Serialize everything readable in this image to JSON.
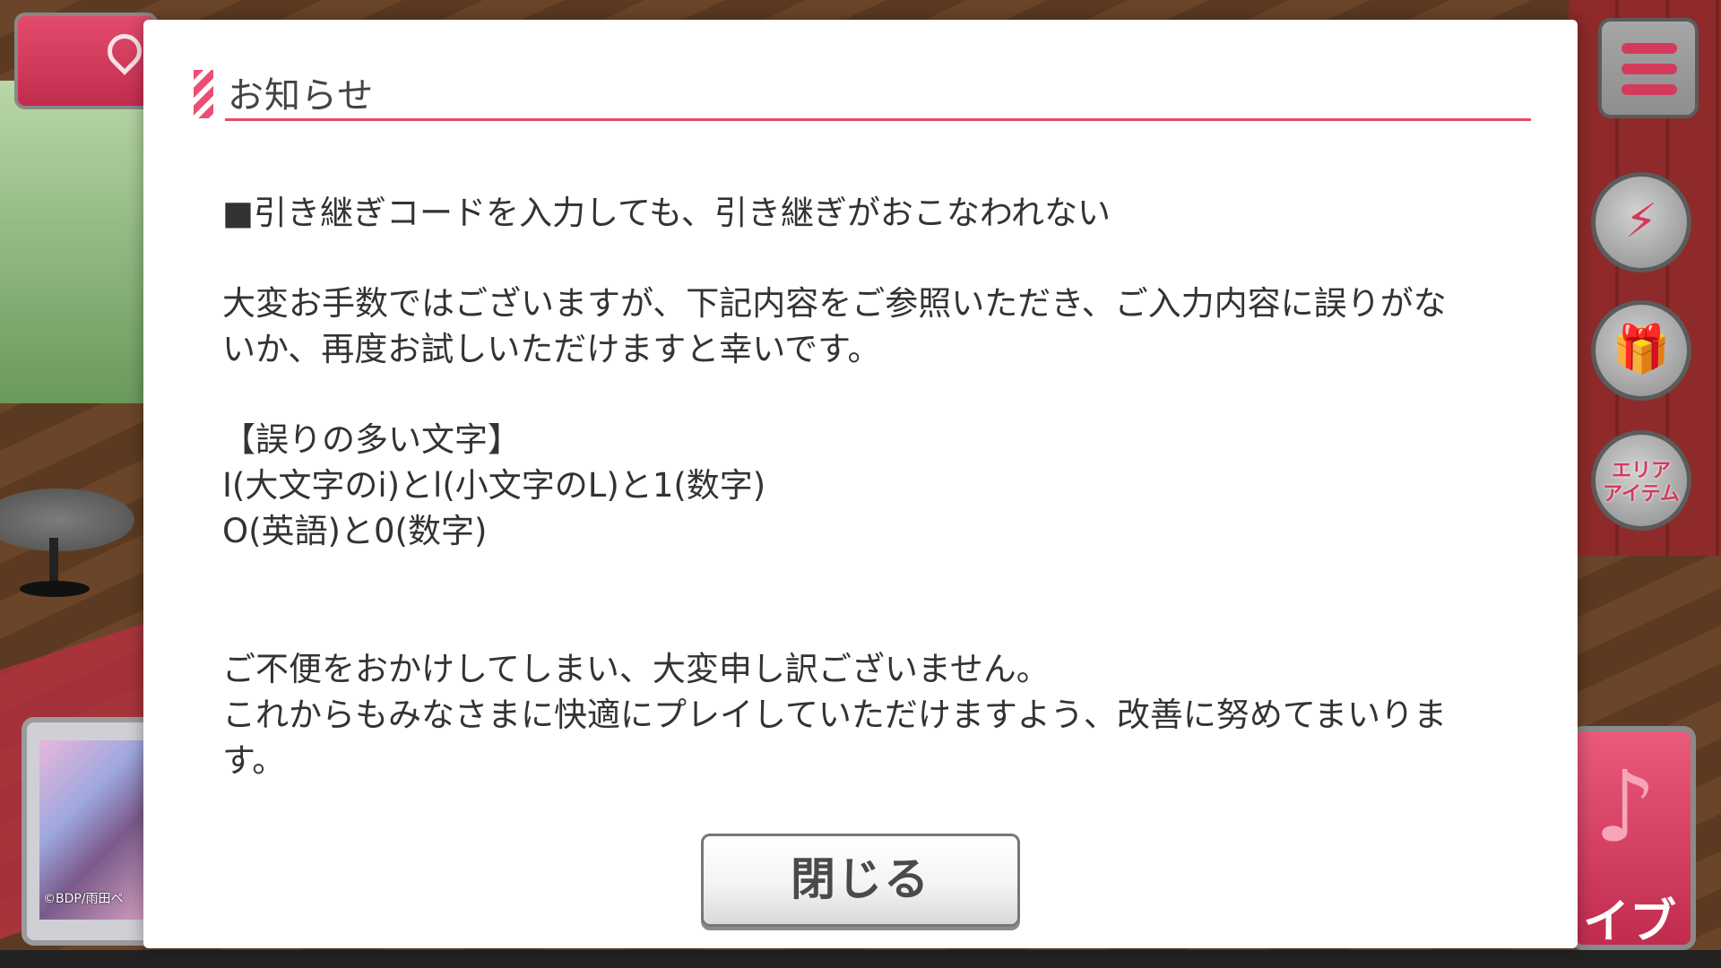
{
  "dialog": {
    "title": "お知らせ",
    "heading": "■引き継ぎコードを入力しても、引き継ぎがおこなわれない",
    "paragraph1_line1": "大変お手数ではございますが、下記内容をご参照いただき、ご入力内容に誤りがな",
    "paragraph1_line2": "いか、再度お試しいただけますと幸いです。",
    "list_heading": "【誤りの多い文字】",
    "list_item1": "I(大文字のi)とl(小文字のL)と1(数字)",
    "list_item2": "O(英語)と0(数字)",
    "closing_line1": "ご不便をおかけしてしまい、大変申し訳ございません。",
    "closing_line2": "これからもみなさまに快適にプレイしていただけますよう、改善に努めてまいりま",
    "closing_line3": "す。",
    "close_button_label": "閉じる"
  },
  "background": {
    "area_item_button_label_line1": "エリア",
    "area_item_button_label_line2": "アイテム",
    "card_credit": "©BDP/雨田ペ",
    "live_button_label": "イブ"
  },
  "icons": {
    "map": "map-pin-icon",
    "menu": "hamburger-menu-icon",
    "event": "lightning-star-icon",
    "gift": "gift-icon",
    "live": "music-note-icon"
  },
  "colors": {
    "accent": "#e34b6c",
    "dialog_bg": "#ffffff",
    "text": "#333333"
  }
}
